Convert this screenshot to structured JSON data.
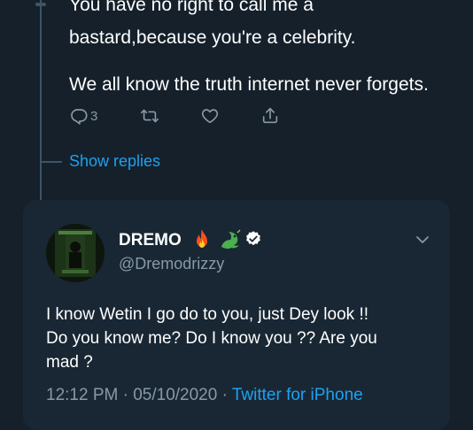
{
  "reply": {
    "line1": "You have no right to call me a",
    "line2": "bastard,because you're a celebrity.",
    "line3": "We all know the truth internet never forgets.",
    "reply_count": "3",
    "show_replies": "Show replies"
  },
  "icons": {
    "reply": "reply-icon",
    "retweet": "retweet-icon",
    "like": "heart-icon",
    "share": "share-icon",
    "fire": "fire-emoji",
    "dragon": "dragon-emoji",
    "verified": "verified-badge-icon",
    "chevron": "chevron-down-icon"
  },
  "tweet": {
    "author_name": "DREMO",
    "handle": "@Dremodrizzy",
    "text_lines": [
      "I know Wetin I go do to you, just Dey look !!",
      "Do you know me? Do I know you ?? Are you",
      "mad ?"
    ],
    "time": "12:12 PM",
    "separator": " · ",
    "date": "05/10/2020",
    "source": "Twitter for iPhone"
  },
  "colors": {
    "background": "#15202b",
    "card": "#192734",
    "accent": "#1da1f2",
    "muted": "#8899a6",
    "thread_line": "#3d5466"
  }
}
